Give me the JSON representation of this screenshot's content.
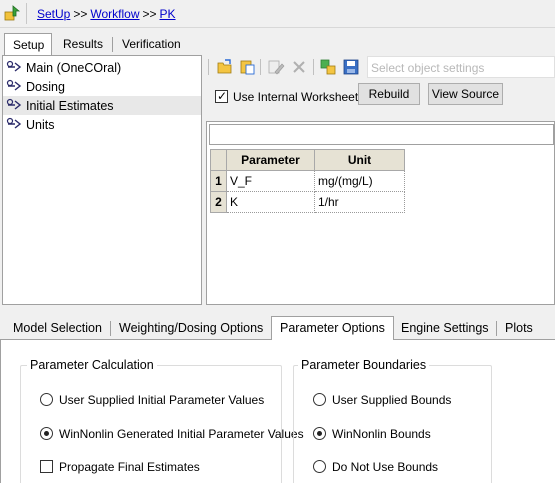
{
  "breadcrumb": {
    "items": [
      "SetUp",
      "Workflow",
      "PK"
    ],
    "separator": ">>"
  },
  "top_tabs": [
    {
      "label": "Setup",
      "active": true
    },
    {
      "label": "Results",
      "active": false
    },
    {
      "label": "Verification",
      "active": false
    }
  ],
  "tree": {
    "items": [
      {
        "label": "Main (OneCOral)",
        "selected": false
      },
      {
        "label": "Dosing",
        "selected": false
      },
      {
        "label": "Initial Estimates",
        "selected": true
      },
      {
        "label": "Units",
        "selected": false
      }
    ]
  },
  "toolbar": {
    "icons": [
      "open-folder-icon",
      "paste-icon",
      "edit-icon",
      "delete-icon",
      "link-icon",
      "save-icon"
    ],
    "object_select_placeholder": "Select object settings"
  },
  "worksheet": {
    "use_internal_label": "Use Internal Worksheet",
    "use_internal_checked": true,
    "rebuild_label": "Rebuild",
    "view_source_label": "View Source"
  },
  "grid": {
    "columns": [
      "Parameter",
      "Unit"
    ],
    "rows": [
      {
        "num": "1",
        "parameter": "V_F",
        "unit": "mg/(mg/L)"
      },
      {
        "num": "2",
        "parameter": "K",
        "unit": "1/hr"
      }
    ]
  },
  "bottom_tabs": [
    {
      "label": "Model Selection",
      "active": false
    },
    {
      "label": "Weighting/Dosing Options",
      "active": false
    },
    {
      "label": "Parameter Options",
      "active": true
    },
    {
      "label": "Engine Settings",
      "active": false
    },
    {
      "label": "Plots",
      "active": false
    }
  ],
  "parameter_calculation": {
    "title": "Parameter Calculation",
    "options": [
      {
        "label": "User Supplied Initial Parameter Values",
        "selected": false
      },
      {
        "label": "WinNonlin Generated Initial Parameter Values",
        "selected": true
      }
    ],
    "propagate_label": "Propagate Final Estimates",
    "propagate_checked": false
  },
  "parameter_boundaries": {
    "title": "Parameter Boundaries",
    "options": [
      {
        "label": "User Supplied Bounds",
        "selected": false
      },
      {
        "label": "WinNonlin Bounds",
        "selected": true
      },
      {
        "label": "Do Not Use Bounds",
        "selected": false
      }
    ]
  },
  "colors": {
    "link": "#0000cc",
    "grid_header": "#e6e2d4",
    "selection": "#e8e8e8"
  }
}
